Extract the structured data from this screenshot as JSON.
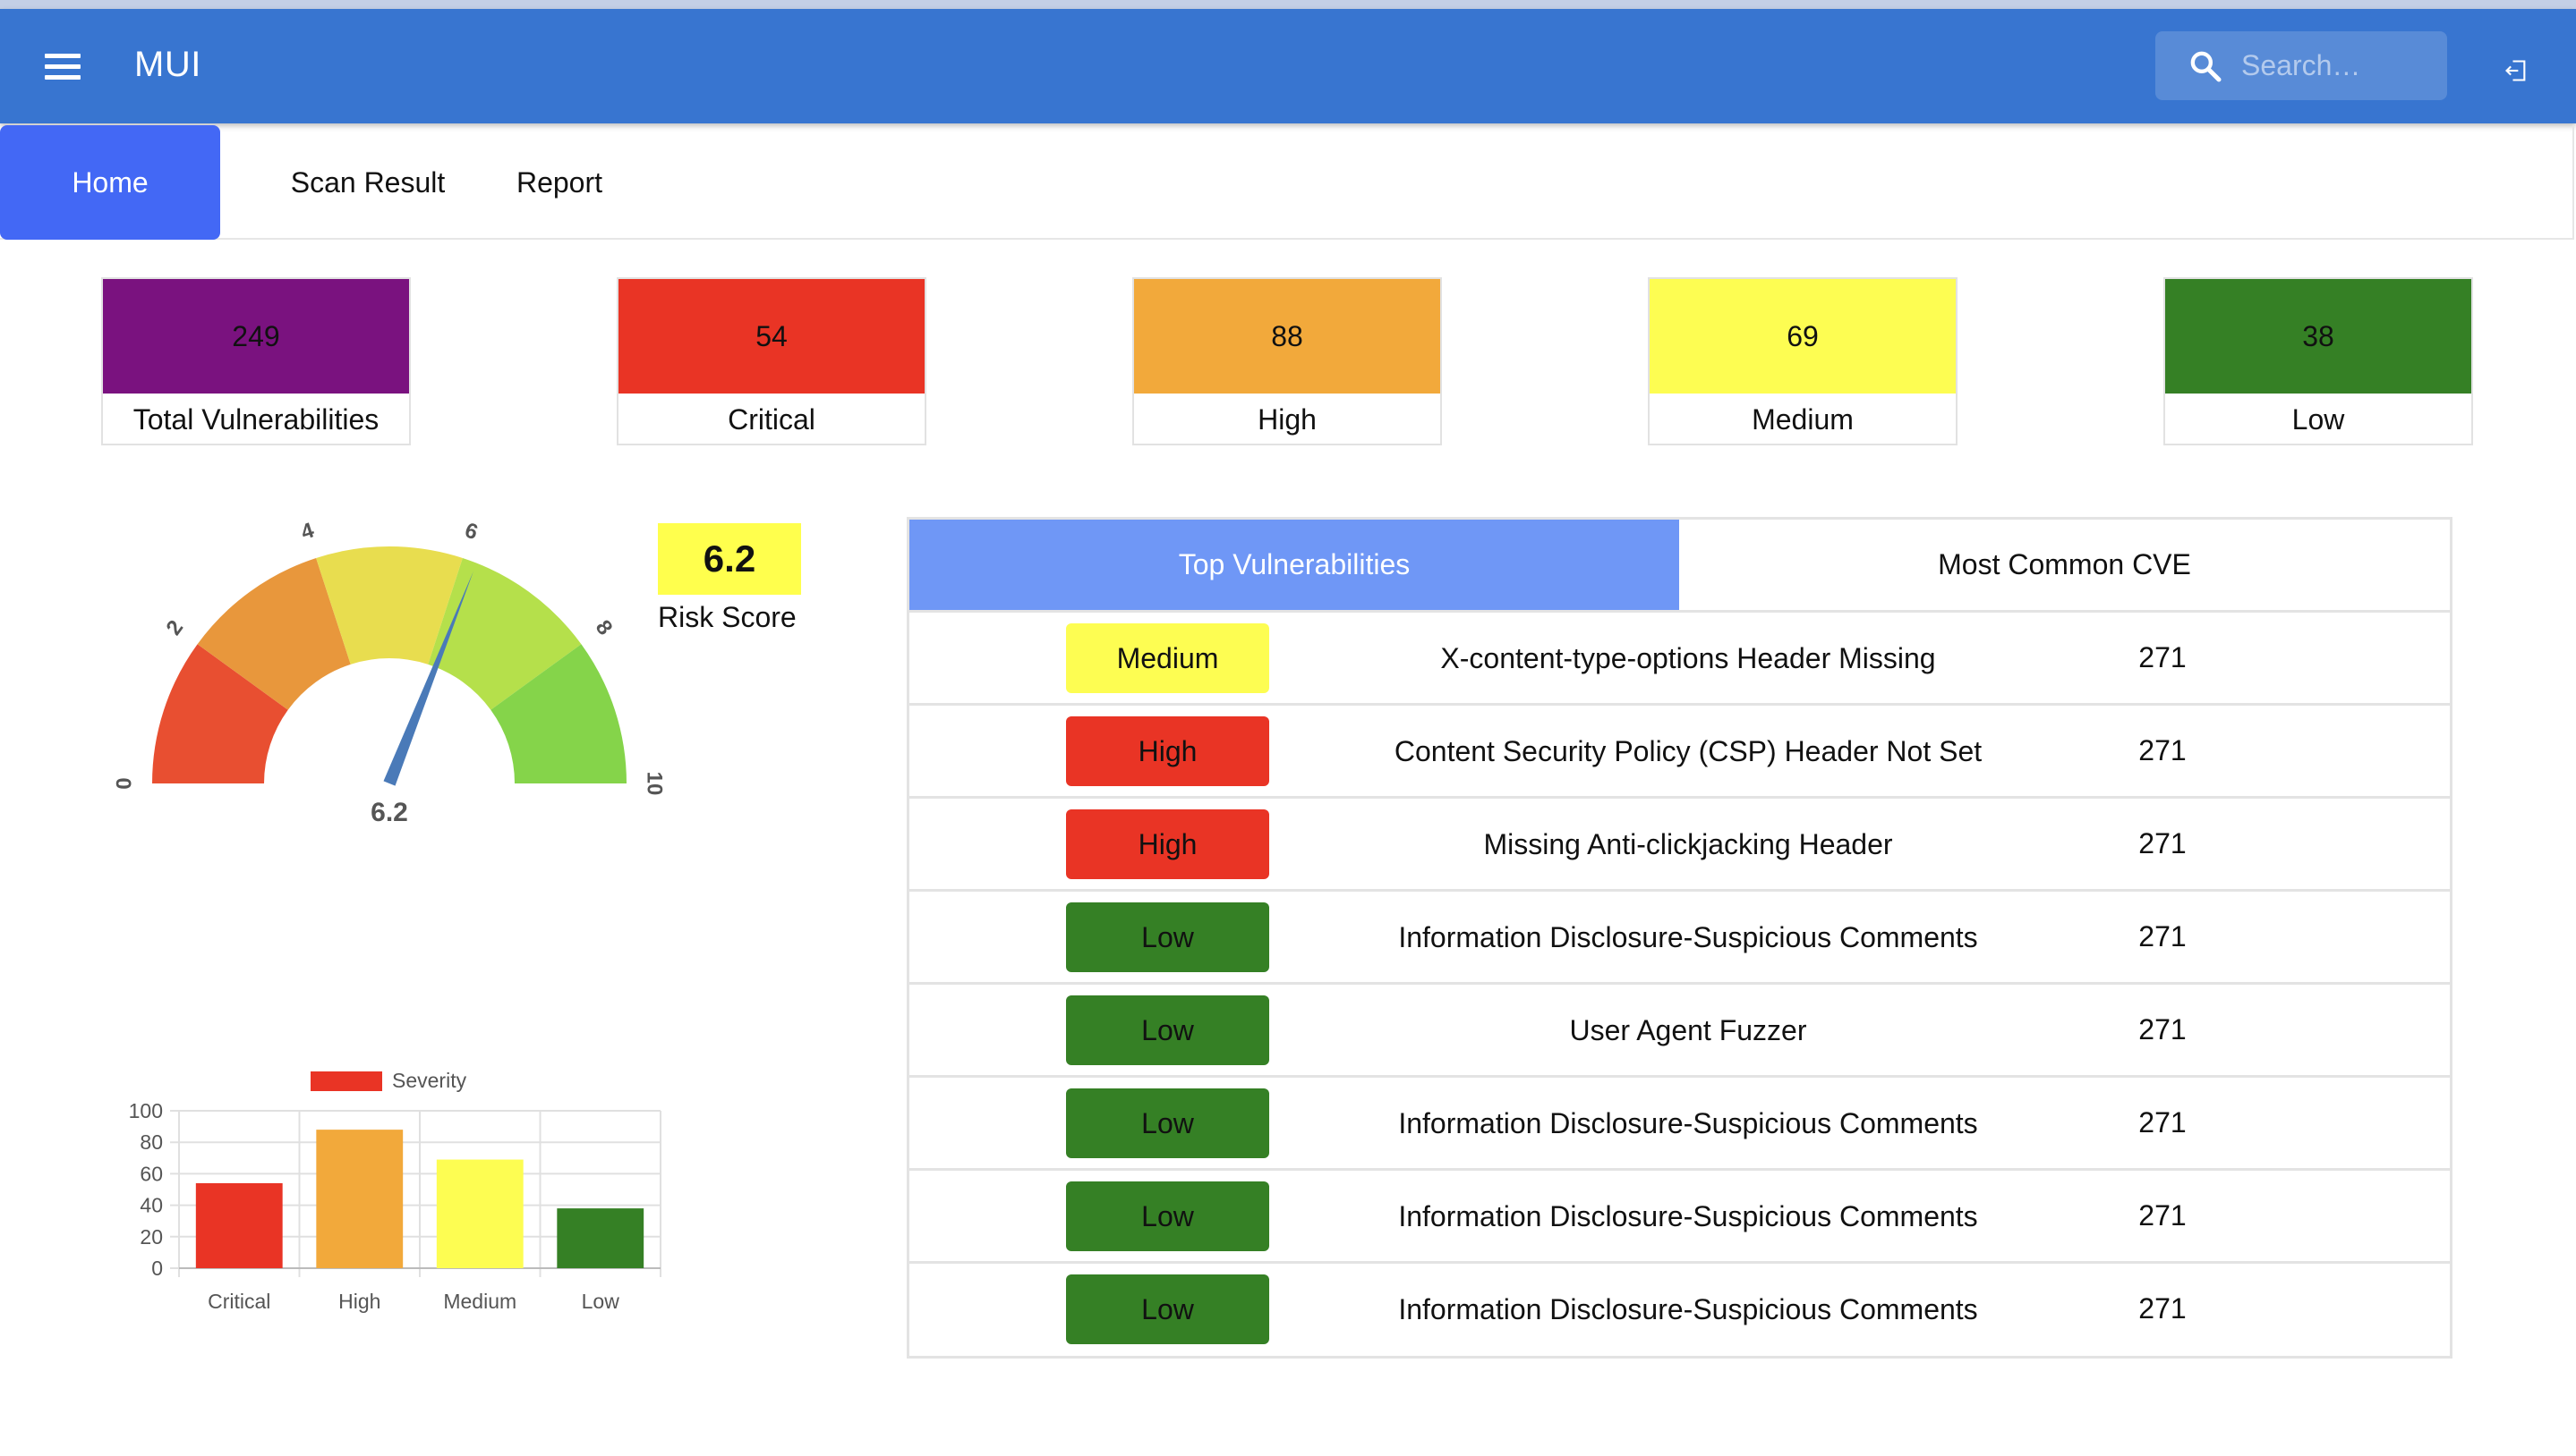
{
  "app": {
    "title": "MUI"
  },
  "search": {
    "placeholder": "Search…"
  },
  "tabs": [
    {
      "label": "Home",
      "active": true
    },
    {
      "label": "Scan Result",
      "active": false
    },
    {
      "label": "Report",
      "active": false
    }
  ],
  "cards": [
    {
      "value": "249",
      "label": "Total Vulnerabilities",
      "color": "#7a127f"
    },
    {
      "value": "54",
      "label": "Critical",
      "color": "#e93425"
    },
    {
      "value": "88",
      "label": "High",
      "color": "#f2a93b"
    },
    {
      "value": "69",
      "label": "Medium",
      "color": "#fdfd52"
    },
    {
      "value": "38",
      "label": "Low",
      "color": "#358025"
    }
  ],
  "gauge": {
    "value": 6.2,
    "value_label": "6.2",
    "min": 0,
    "max": 10,
    "ticks": [
      "0",
      "2",
      "4",
      "6",
      "8",
      "10"
    ],
    "segment_colors": [
      "#e84f31",
      "#e8973c",
      "#e8dd4f",
      "#b5e04b",
      "#85d44a"
    ],
    "needle_color": "#4a7ab8"
  },
  "risk": {
    "score": "6.2",
    "label": "Risk Score"
  },
  "chart_data": {
    "type": "bar",
    "categories": [
      "Critical",
      "High",
      "Medium",
      "Low"
    ],
    "series": [
      {
        "name": "Severity",
        "values": [
          54,
          88,
          69,
          38
        ]
      }
    ],
    "colors": [
      "#e93425",
      "#f2a93b",
      "#fdfd52",
      "#358025"
    ],
    "ylim": [
      0,
      100
    ],
    "yticks": [
      "0",
      "20",
      "40",
      "60",
      "80",
      "100"
    ],
    "legend": "top",
    "grid": true
  },
  "table": {
    "tabs": [
      {
        "label": "Top Vulnerabilities",
        "active": true
      },
      {
        "label": "Most Common CVE",
        "active": false
      }
    ],
    "severity_colors": {
      "Medium": "#fdfd52",
      "High": "#e93425",
      "Low": "#358025"
    },
    "rows": [
      {
        "severity": "Medium",
        "name": "X-content-type-options Header Missing",
        "count": "271"
      },
      {
        "severity": "High",
        "name": "Content Security Policy (CSP) Header Not Set",
        "count": "271"
      },
      {
        "severity": "High",
        "name": "Missing Anti-clickjacking Header",
        "count": "271"
      },
      {
        "severity": "Low",
        "name": "Information Disclosure-Suspicious Comments",
        "count": "271"
      },
      {
        "severity": "Low",
        "name": "User Agent Fuzzer",
        "count": "271"
      },
      {
        "severity": "Low",
        "name": "Information Disclosure-Suspicious Comments",
        "count": "271"
      },
      {
        "severity": "Low",
        "name": "Information Disclosure-Suspicious Comments",
        "count": "271"
      },
      {
        "severity": "Low",
        "name": "Information Disclosure-Suspicious Comments",
        "count": "271"
      }
    ]
  }
}
